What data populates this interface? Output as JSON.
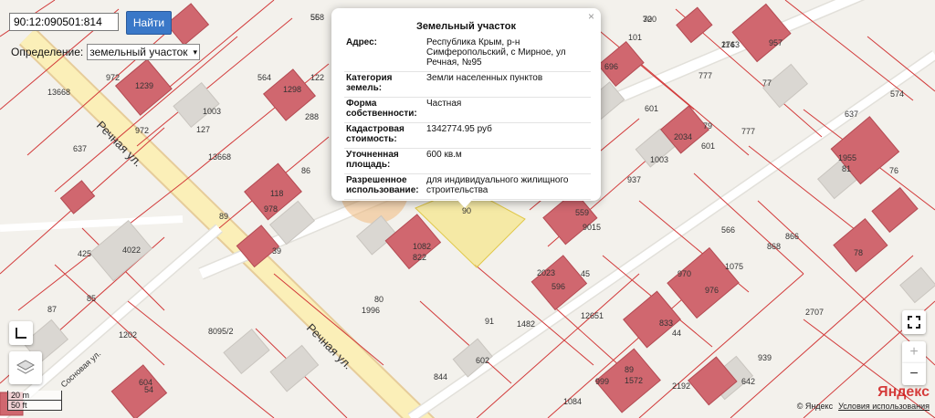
{
  "search": {
    "value": "90:12:090501:814",
    "button_label": "Найти"
  },
  "definition": {
    "label": "Определение:",
    "selected": "земельный участок"
  },
  "popup": {
    "title": "Земельный участок",
    "rows": [
      {
        "key": "Адрес:",
        "value": "Республика Крым, р-н Симферопольский, с Мирное, ул Речная, №95"
      },
      {
        "key": "Категория земель:",
        "value": "Земли населенных пунктов"
      },
      {
        "key": "Форма собственности:",
        "value": "Частная"
      },
      {
        "key": "Кадастровая стоимость:",
        "value": "1342774.95 руб"
      },
      {
        "key": "Уточненная площадь:",
        "value": "600 кв.м"
      },
      {
        "key": "Разрешенное использование:",
        "value": "для индивидуального жилищного строительства"
      }
    ]
  },
  "streets": [
    "Речная ул.",
    "Речная ул.",
    "Сосновая ул."
  ],
  "parcel_labels": [
    "558",
    "720",
    "2763",
    "957",
    "972",
    "1239",
    "564",
    "1298",
    "122",
    "77",
    "777",
    "601",
    "1000",
    "696",
    "101",
    "574",
    "637",
    "13668",
    "972",
    "288",
    "127",
    "1003",
    "79",
    "2034",
    "601",
    "777",
    "1955",
    "637",
    "13668",
    "1003",
    "81",
    "76",
    "978",
    "118",
    "937",
    "559",
    "9015",
    "566",
    "868",
    "866",
    "78",
    "425",
    "4022",
    "39",
    "1082",
    "822",
    "2023",
    "596",
    "970",
    "1075",
    "976",
    "80",
    "1996",
    "91",
    "1482",
    "12651",
    "87",
    "8095/2",
    "833",
    "44",
    "2707",
    "939",
    "844",
    "602",
    "999",
    "89",
    "1572",
    "2192",
    "642",
    "604",
    "54",
    "1084",
    "45",
    "89",
    "86",
    "85",
    "1202",
    "82",
    "90",
    "56",
    "30",
    "114"
  ],
  "scale": {
    "metric": "20 m",
    "imperial": "50 ft"
  },
  "footer": {
    "copyright": "© Яндекс",
    "terms": "Условия использования",
    "logo": "Яндекс"
  },
  "controls": {
    "zoom_in": "+",
    "zoom_out": "−"
  }
}
